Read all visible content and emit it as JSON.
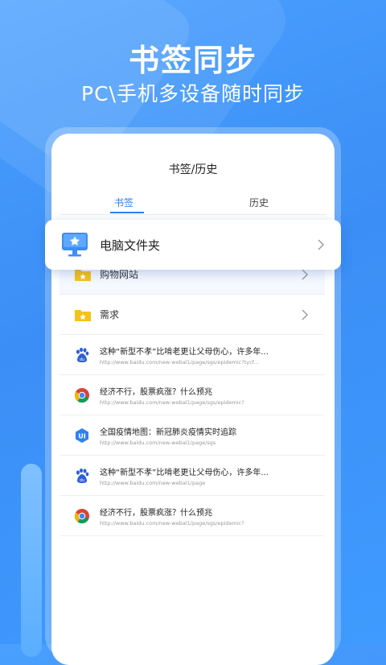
{
  "hero": {
    "title": "书签同步",
    "subtitle": "PC\\手机多设备随时同步"
  },
  "card": {
    "title": "书签/历史",
    "tabs": [
      {
        "label": "书签"
      },
      {
        "label": "历史"
      }
    ]
  },
  "popup": {
    "label": "电脑文件夹",
    "icon": "desktop-star-icon"
  },
  "folders": [
    {
      "label": "购物网站",
      "icon": "folder-star-icon"
    },
    {
      "label": "需求",
      "icon": "folder-star-icon"
    }
  ],
  "links": [
    {
      "title": "这种“新型不孝”比啃老更让父母伤心，许多年...",
      "url": "http://www.baidu.com/new-webal1/page/sgs/epidemic?tycf...",
      "icon": "baidu-paw-icon"
    },
    {
      "title": "经济不行，股票疯涨？什么预兆",
      "url": "http://www.baidu.com/new-webal1/page/sgs/epidemic?",
      "icon": "chrome-icon"
    },
    {
      "title": "全国疫情地图：新冠肺炎疫情实时追踪",
      "url": "http://www.baidu.com/new-webal1/page/sgs",
      "icon": "ui-badge-icon"
    },
    {
      "title": "这种“新型不孝”比啃老更让父母伤心，许多年...",
      "url": "http://www.baidu.com/new-webal1/page",
      "icon": "baidu-paw-icon"
    },
    {
      "title": "经济不行，股票疯涨？什么预兆",
      "url": "http://www.baidu.com/new-webal1/page/sgs/epidemic?",
      "icon": "chrome-icon"
    }
  ],
  "colors": {
    "accent": "#2f80f5",
    "background": "#3f9bff",
    "folder": "#f5c21b"
  }
}
